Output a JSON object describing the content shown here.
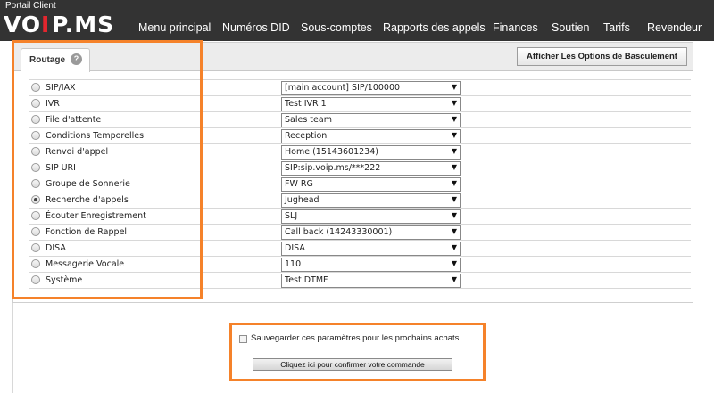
{
  "header": {
    "portal_label": "Portail Client",
    "logo_text": "VOIP.MS",
    "nav": [
      "Menu principal",
      "Numéros DID",
      "Sous-comptes",
      "Rapports des appels",
      "Finances",
      "Soutien",
      "Tarifs",
      "Revendeur"
    ]
  },
  "panel": {
    "tab_label": "Routage",
    "help_glyph": "?",
    "toggle_button": "Afficher Les Options de Basculement"
  },
  "routing": [
    {
      "label": "SIP/IAX",
      "value": "[main account] SIP/100000",
      "checked": false
    },
    {
      "label": "IVR",
      "value": "Test IVR 1",
      "checked": false
    },
    {
      "label": "File d'attente",
      "value": "Sales team",
      "checked": false
    },
    {
      "label": "Conditions Temporelles",
      "value": "Reception",
      "checked": false
    },
    {
      "label": "Renvoi d'appel",
      "value": "Home (15143601234)",
      "checked": false
    },
    {
      "label": "SIP URI",
      "value": "SIP:sip.voip.ms/***222",
      "checked": false
    },
    {
      "label": "Groupe de Sonnerie",
      "value": "FW RG",
      "checked": false
    },
    {
      "label": "Recherche d'appels",
      "value": "Jughead",
      "checked": true
    },
    {
      "label": "Écouter Enregistrement",
      "value": "SLJ",
      "checked": false
    },
    {
      "label": "Fonction de Rappel",
      "value": "Call back (14243330001)",
      "checked": false
    },
    {
      "label": "DISA",
      "value": "DISA",
      "checked": false
    },
    {
      "label": "Messagerie Vocale",
      "value": "110",
      "checked": false
    },
    {
      "label": "Système",
      "value": "Test DTMF",
      "checked": false
    }
  ],
  "footer": {
    "save_label": "Sauvegarder ces paramètres pour les prochains achats.",
    "confirm_button": "Cliquez ici pour confirmer votre commande"
  },
  "colors": {
    "topbar": "#333333",
    "logo_accent": "#e3262e",
    "highlight": "#f5822a"
  }
}
